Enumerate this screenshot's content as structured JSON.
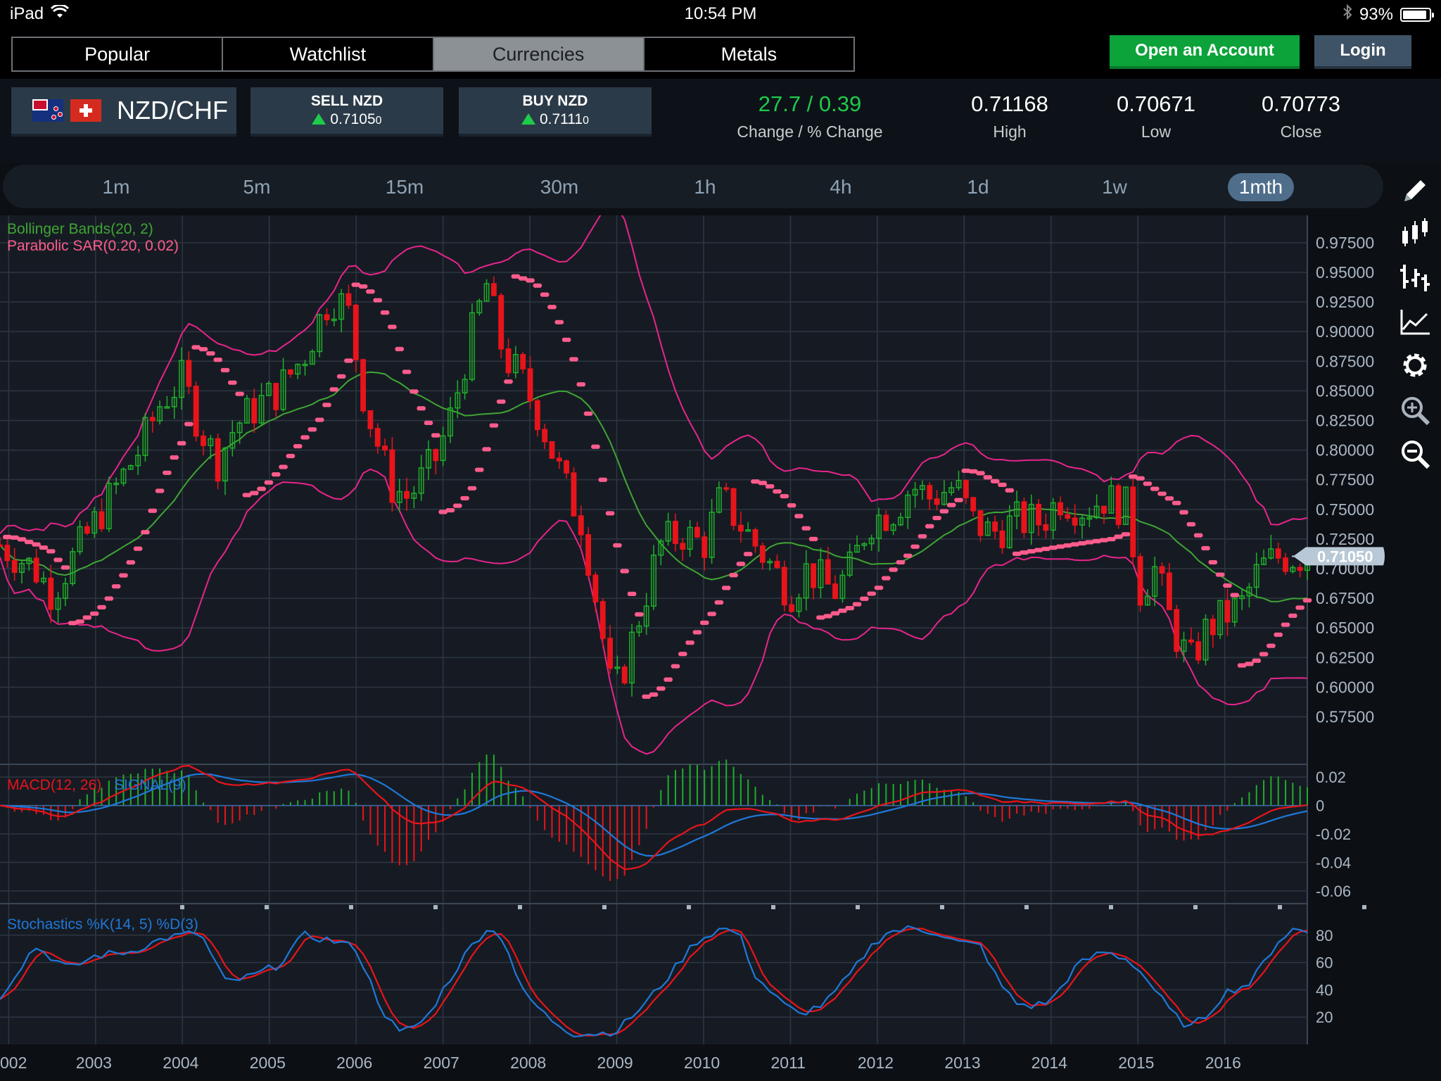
{
  "status_bar": {
    "device": "iPad",
    "time": "10:54 PM",
    "battery": "93%",
    "battery_level": 0.93
  },
  "nav_tabs": [
    {
      "label": "Popular",
      "active": false
    },
    {
      "label": "Watchlist",
      "active": false
    },
    {
      "label": "Currencies",
      "active": true
    },
    {
      "label": "Metals",
      "active": false
    }
  ],
  "header_buttons": {
    "open_account": "Open an Account",
    "login": "Login"
  },
  "instrument": {
    "pair": "NZD/CHF",
    "base_flag": "nz-flag-icon",
    "quote_flag": "ch-flag-icon"
  },
  "sell": {
    "label": "SELL NZD",
    "price": "0.7105",
    "price_small": "0"
  },
  "buy": {
    "label": "BUY NZD",
    "price": "0.7111",
    "price_small": "0"
  },
  "stats": {
    "change": "27.7 / 0.39",
    "change_label": "Change / % Change",
    "high": "0.71168",
    "high_label": "High",
    "low": "0.70671",
    "low_label": "Low",
    "close": "0.70773",
    "close_label": "Close"
  },
  "timeframes": [
    {
      "label": "1m",
      "active": false
    },
    {
      "label": "5m",
      "active": false
    },
    {
      "label": "15m",
      "active": false
    },
    {
      "label": "30m",
      "active": false
    },
    {
      "label": "1h",
      "active": false
    },
    {
      "label": "4h",
      "active": false
    },
    {
      "label": "1d",
      "active": false
    },
    {
      "label": "1w",
      "active": false
    },
    {
      "label": "1mth",
      "active": true
    }
  ],
  "side_tools": [
    "pencil-icon",
    "candlestick-icon",
    "ohlc-bars-icon",
    "line-chart-icon",
    "gear-icon",
    "zoom-in-icon",
    "zoom-out-icon"
  ],
  "colors": {
    "up": "#1fae2a",
    "down": "#e8141b",
    "bollinger_mid": "#3fa534",
    "bollinger_band": "#e8248c",
    "sar": "#ff5c8d",
    "macd": "#e8141b",
    "signal": "#1f78d8",
    "price_tag": "#b8c8d6"
  },
  "chart_data": [
    {
      "type": "candlestick",
      "title": "",
      "indicators": [
        "Bollinger Bands(20, 2)",
        "Parabolic SAR(0.20, 0.02)"
      ],
      "x_ticks": [
        "002",
        "2003",
        "2004",
        "2005",
        "2006",
        "2007",
        "2008",
        "2009",
        "2010",
        "2011",
        "2012",
        "2013",
        "2014",
        "2015",
        "2016"
      ],
      "x_range": [
        2001.9,
        2016.95
      ],
      "y_ticks": [
        "0.97500",
        "0.95000",
        "0.92500",
        "0.90000",
        "0.87500",
        "0.85000",
        "0.82500",
        "0.80000",
        "0.77500",
        "0.75000",
        "0.72500",
        "0.70000",
        "0.67500",
        "0.65000",
        "0.62500",
        "0.60000",
        "0.57500"
      ],
      "ylim": [
        0.5575,
        0.985
      ],
      "last_price": "0.71050",
      "last_price_value": 0.7105,
      "anchors": [
        [
          2001.9,
          0.72
        ],
        [
          2002.3,
          0.7
        ],
        [
          2002.5,
          0.68
        ],
        [
          2002.75,
          0.71
        ],
        [
          2003.0,
          0.74
        ],
        [
          2003.25,
          0.77
        ],
        [
          2003.5,
          0.8
        ],
        [
          2003.75,
          0.84
        ],
        [
          2004.0,
          0.86
        ],
        [
          2004.2,
          0.82
        ],
        [
          2004.4,
          0.79
        ],
        [
          2004.6,
          0.82
        ],
        [
          2004.9,
          0.84
        ],
        [
          2005.1,
          0.85
        ],
        [
          2005.4,
          0.88
        ],
        [
          2005.7,
          0.93
        ],
        [
          2005.9,
          0.92
        ],
        [
          2006.1,
          0.84
        ],
        [
          2006.4,
          0.77
        ],
        [
          2006.6,
          0.76
        ],
        [
          2006.9,
          0.79
        ],
        [
          2007.1,
          0.83
        ],
        [
          2007.3,
          0.89
        ],
        [
          2007.5,
          0.94
        ],
        [
          2007.7,
          0.88
        ],
        [
          2007.9,
          0.86
        ],
        [
          2008.1,
          0.83
        ],
        [
          2008.4,
          0.77
        ],
        [
          2008.6,
          0.74
        ],
        [
          2008.8,
          0.66
        ],
        [
          2008.95,
          0.59
        ],
        [
          2009.1,
          0.62
        ],
        [
          2009.3,
          0.67
        ],
        [
          2009.5,
          0.72
        ],
        [
          2009.75,
          0.73
        ],
        [
          2010.0,
          0.72
        ],
        [
          2010.2,
          0.76
        ],
        [
          2010.5,
          0.73
        ],
        [
          2010.8,
          0.7
        ],
        [
          2011.0,
          0.68
        ],
        [
          2011.2,
          0.7
        ],
        [
          2011.5,
          0.68
        ],
        [
          2011.7,
          0.7
        ],
        [
          2011.9,
          0.74
        ],
        [
          2012.2,
          0.75
        ],
        [
          2012.4,
          0.77
        ],
        [
          2012.6,
          0.76
        ],
        [
          2012.9,
          0.77
        ],
        [
          2013.1,
          0.74
        ],
        [
          2013.3,
          0.73
        ],
        [
          2013.6,
          0.74
        ],
        [
          2013.9,
          0.74
        ],
        [
          2014.1,
          0.76
        ],
        [
          2014.4,
          0.75
        ],
        [
          2014.6,
          0.76
        ],
        [
          2014.9,
          0.75
        ],
        [
          2015.0,
          0.68
        ],
        [
          2015.2,
          0.7
        ],
        [
          2015.4,
          0.65
        ],
        [
          2015.6,
          0.62
        ],
        [
          2015.8,
          0.65
        ],
        [
          2016.0,
          0.66
        ],
        [
          2016.2,
          0.67
        ],
        [
          2016.4,
          0.7
        ],
        [
          2016.6,
          0.71
        ],
        [
          2016.8,
          0.71
        ],
        [
          2016.95,
          0.7105
        ]
      ]
    },
    {
      "type": "line",
      "title": "",
      "legend": [
        {
          "name": "MACD(12, 26)",
          "color": "#e8141b"
        },
        {
          "name": "SIGNAL(9)",
          "color": "#1f78d8"
        }
      ],
      "y_ticks": [
        "0.02",
        "0",
        "-0.02",
        "-0.04",
        "-0.06"
      ],
      "ylim": [
        -0.066,
        0.026
      ]
    },
    {
      "type": "line",
      "title": "",
      "legend": [
        {
          "name": "Stochastics %K(14, 5) %D(3)",
          "color": "#1f78d8"
        }
      ],
      "y_ticks": [
        "80",
        "60",
        "40",
        "20"
      ],
      "ylim": [
        0,
        100
      ],
      "anchors": [
        [
          2001.9,
          35
        ],
        [
          2002.3,
          72
        ],
        [
          2002.7,
          55
        ],
        [
          2003.0,
          65
        ],
        [
          2003.4,
          68
        ],
        [
          2003.8,
          78
        ],
        [
          2004.2,
          82
        ],
        [
          2004.5,
          45
        ],
        [
          2004.8,
          50
        ],
        [
          2005.1,
          58
        ],
        [
          2005.4,
          80
        ],
        [
          2005.8,
          75
        ],
        [
          2006.0,
          70
        ],
        [
          2006.3,
          25
        ],
        [
          2006.5,
          8
        ],
        [
          2006.8,
          18
        ],
        [
          2007.0,
          40
        ],
        [
          2007.3,
          70
        ],
        [
          2007.5,
          85
        ],
        [
          2007.7,
          78
        ],
        [
          2007.9,
          40
        ],
        [
          2008.2,
          20
        ],
        [
          2008.5,
          8
        ],
        [
          2008.8,
          8
        ],
        [
          2009.0,
          10
        ],
        [
          2009.3,
          28
        ],
        [
          2009.6,
          50
        ],
        [
          2009.9,
          75
        ],
        [
          2010.2,
          85
        ],
        [
          2010.4,
          82
        ],
        [
          2010.6,
          50
        ],
        [
          2010.9,
          30
        ],
        [
          2011.1,
          22
        ],
        [
          2011.4,
          30
        ],
        [
          2011.7,
          52
        ],
        [
          2011.9,
          70
        ],
        [
          2012.1,
          82
        ],
        [
          2012.4,
          85
        ],
        [
          2012.7,
          82
        ],
        [
          2012.9,
          75
        ],
        [
          2013.2,
          72
        ],
        [
          2013.4,
          45
        ],
        [
          2013.6,
          30
        ],
        [
          2013.8,
          28
        ],
        [
          2014.0,
          32
        ],
        [
          2014.3,
          58
        ],
        [
          2014.6,
          68
        ],
        [
          2014.9,
          62
        ],
        [
          2015.1,
          48
        ],
        [
          2015.4,
          22
        ],
        [
          2015.6,
          12
        ],
        [
          2015.8,
          22
        ],
        [
          2016.0,
          38
        ],
        [
          2016.3,
          45
        ],
        [
          2016.6,
          75
        ],
        [
          2016.8,
          85
        ],
        [
          2016.95,
          82
        ]
      ]
    }
  ]
}
